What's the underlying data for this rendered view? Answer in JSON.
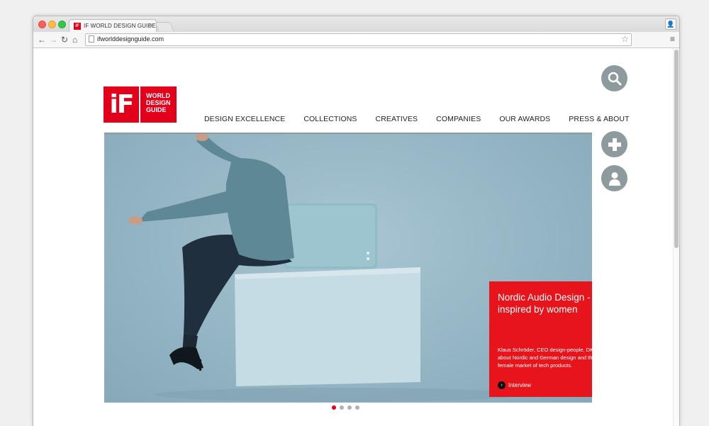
{
  "browser": {
    "tab_title": "IF WORLD DESIGN GUIDE",
    "tab_favicon": "iF",
    "url": "ifworlddesignguide.com"
  },
  "logo": {
    "mark": "iF",
    "line1": "WORLD",
    "line2": "DESIGN",
    "line3": "GUIDE"
  },
  "nav": {
    "items": [
      "DESIGN EXCELLENCE",
      "COLLECTIONS",
      "CREATIVES",
      "COMPANIES",
      "OUR AWARDS",
      "PRESS & ABOUT"
    ]
  },
  "feature": {
    "title": "Nordic Audio Design - inspired by women",
    "description": "Klaus Schröder, CEO design-people, DK, about Nordic and German design and the female market of tech products.",
    "link_label": "Interview"
  },
  "carousel": {
    "slide_count": 4,
    "active_index": 0
  },
  "colors": {
    "brand_red": "#e3001b",
    "feature_red": "#e8141c",
    "side_button_gray": "#8d9a9e"
  },
  "icons": {
    "search": "search-icon",
    "add": "plus-icon",
    "account": "user-icon"
  }
}
